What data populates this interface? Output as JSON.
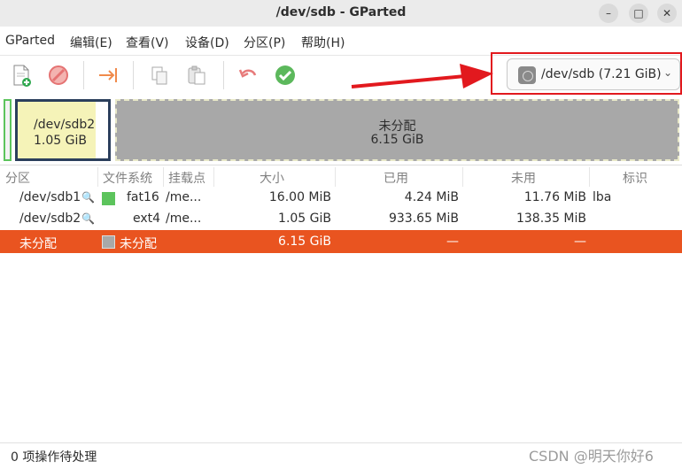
{
  "window": {
    "title": "/dev/sdb - GParted"
  },
  "menu": [
    "GParted",
    "编辑(E)",
    "查看(V)",
    "设备(D)",
    "分区(P)",
    "帮助(H)"
  ],
  "device": {
    "label": "/dev/sdb (7.21 GiB)"
  },
  "map": {
    "sdb2": {
      "name": "/dev/sdb2",
      "size": "1.05 GiB"
    },
    "unallocated": {
      "name": "未分配",
      "size": "6.15 GiB"
    }
  },
  "table": {
    "headers": [
      "分区",
      "文件系统",
      "挂载点",
      "大小",
      "已用",
      "未用",
      "标识"
    ],
    "rows": [
      {
        "partition": "/dev/sdb1",
        "fs": "fat16",
        "mount": "/me...",
        "size": "16.00 MiB",
        "used": "4.24 MiB",
        "unused": "11.76 MiB",
        "flags": "lba",
        "color": "#5cc45c"
      },
      {
        "partition": "/dev/sdb2",
        "fs": "ext4",
        "mount": "/me...",
        "size": "1.05 GiB",
        "used": "933.65 MiB",
        "unused": "138.35 MiB",
        "flags": "",
        "color": ""
      },
      {
        "partition": "未分配",
        "fs": "未分配",
        "mount": "",
        "size": "6.15 GiB",
        "used": "—",
        "unused": "—",
        "flags": "",
        "color": "#a8a8a8"
      }
    ]
  },
  "status": {
    "text": "0 项操作待处理"
  },
  "watermark": "CSDN @明天你好6",
  "colors": {
    "accent": "#e95420",
    "highlight": "#e2191e"
  }
}
